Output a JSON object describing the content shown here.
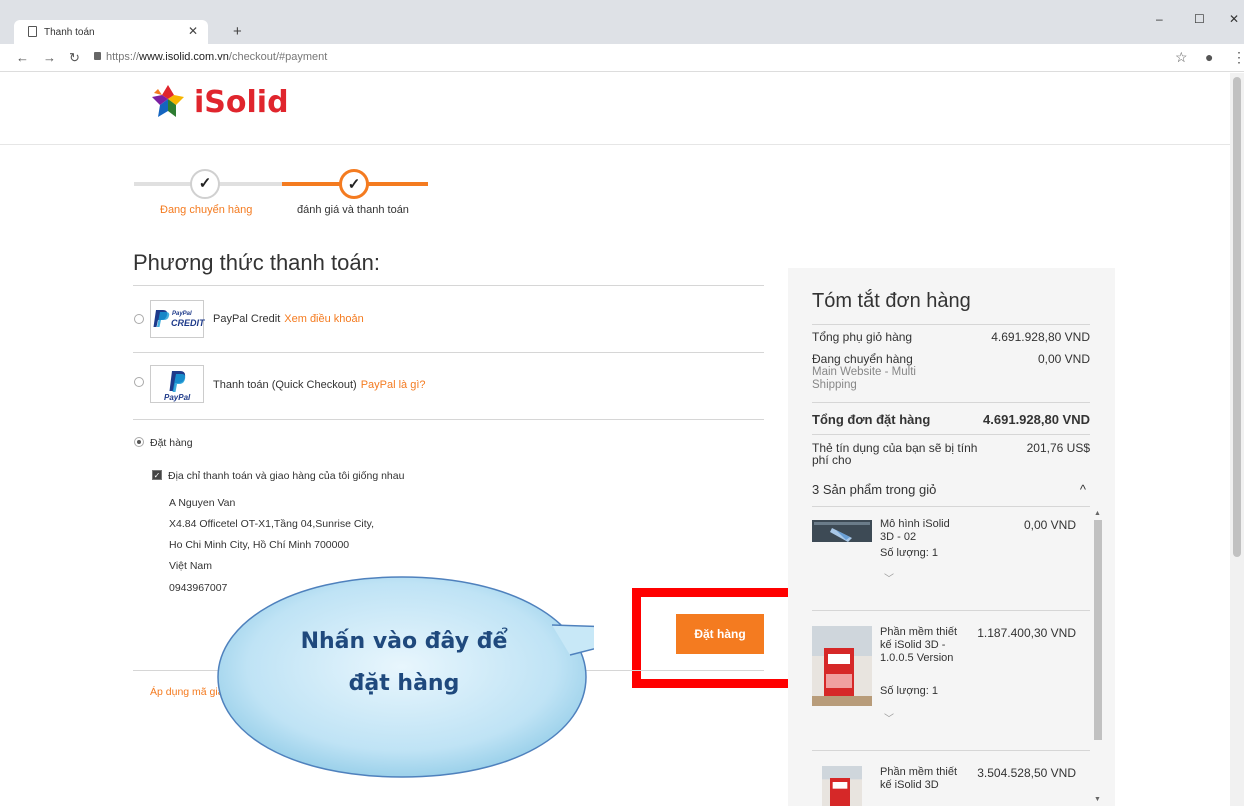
{
  "browser": {
    "tab_title": "Thanh toán",
    "url_scheme": "https://",
    "url_host": "www.isolid.com.vn",
    "url_path": "/checkout/#payment"
  },
  "brand": {
    "name": "iSolid"
  },
  "steps": [
    {
      "label": "Đang chuyển hàng",
      "color": "#f47b20"
    },
    {
      "label": "đánh giá và thanh toán",
      "color": "#333333"
    }
  ],
  "payment": {
    "heading": "Phương thức thanh toán:",
    "options": [
      {
        "logo": "PayPal CREDIT",
        "label": "PayPal Credit",
        "link": "Xem điều khoản",
        "selected": false
      },
      {
        "logo": "PayPal",
        "label": "Thanh toán (Quick Checkout)",
        "link": "PayPal là gì?",
        "selected": false
      },
      {
        "label": "Đặt hàng",
        "selected": true
      }
    ],
    "same_address_label": "Địa chỉ thanh toán và giao hàng của tôi giống nhau",
    "address": [
      "A Nguyen Van",
      "X4.84 Officetel OT-X1,Tầng 04,Sunrise City,",
      "Ho Chi Minh City, Hồ Chí Minh 700000",
      "Việt Nam",
      "0943967007"
    ],
    "place_order_button": "Đặt hàng",
    "discount_link": "Áp dụng mã giảm giá"
  },
  "callout": {
    "line1": "Nhấn vào đây để",
    "line2": "đặt hàng"
  },
  "summary": {
    "title": "Tóm tắt đơn hàng",
    "subtotal_label": "Tổng phụ giỏ hàng",
    "subtotal_value": "4.691.928,80 VND",
    "shipping_label": "Đang chuyển hàng",
    "shipping_method": "Main Website - Multi Shipping",
    "shipping_value": "0,00 VND",
    "total_label": "Tổng đơn đặt hàng",
    "total_value": "4.691.928,80 VND",
    "charge_label": "Thẻ tín dụng của bạn sẽ bị tính phí cho",
    "charge_value": "201,76 US$",
    "items_header": "3 Sản phẩm trong giỏ",
    "items": [
      {
        "name": "Mô hình iSolid 3D - 02",
        "price": "0,00 VND",
        "qty": "Số lượng: 1"
      },
      {
        "name": "Phần mềm thiết kế iSolid 3D - 1.0.0.5 Version",
        "price": "1.187.400,30 VND",
        "qty": "Số lượng: 1"
      },
      {
        "name": "Phần mềm thiết kế iSolid 3D",
        "price": "3.504.528,50 VND",
        "qty": ""
      }
    ]
  },
  "colors": {
    "accent": "#f47b20",
    "brand": "#e0252d",
    "highlight": "#ff0000",
    "callout_text": "#1f497d"
  }
}
